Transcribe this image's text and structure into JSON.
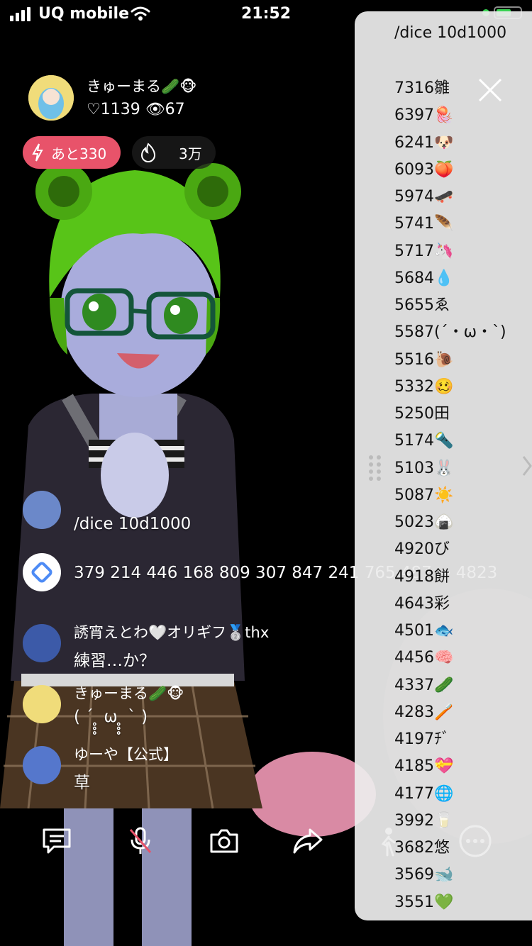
{
  "status_bar": {
    "carrier": "UQ mobile",
    "time": "21:52",
    "signal_icon": "signal-icon",
    "wifi_icon": "wifi-icon",
    "battery_icon": "battery-icon",
    "accent_green": "#39d353"
  },
  "host": {
    "name": "きゅーまる🥒🐵",
    "stats": "♡1139 👁67"
  },
  "pills": {
    "remaining": "あと330",
    "fire_count": "3万",
    "remaining_color": "#e8536a"
  },
  "chat": {
    "messages": [
      {
        "name": "",
        "text": "/dice 10d1000",
        "avatar": "avatar"
      },
      {
        "name": "",
        "text": "379 214 446 168 809 307 847 241 765 487 → 4823",
        "avatar": "bot-logo-icon"
      },
      {
        "name": "誘宵えとわ🤍オリギフ🥈thx",
        "text": "練習…か？",
        "avatar": "avatar"
      },
      {
        "name": "きゅーまる🥒🐵",
        "text": "( ´ ̥̥̥ ω ̥̥̥ ` )",
        "avatar": "avatar"
      },
      {
        "name": "ゆーや【公式】",
        "text": "草",
        "avatar": "avatar"
      }
    ]
  },
  "toolbar": {
    "buttons": [
      "comment-icon",
      "mic-muted-icon",
      "camera-icon",
      "share-icon",
      "person-icon",
      "more-icon"
    ]
  },
  "dice_panel": {
    "command": "/dice 10d1000",
    "results": [
      "7316雛",
      "6397🪼",
      "6241🐶",
      "6093🍑",
      "5974🛹",
      "5741🪶",
      "5717🦄",
      "5684💧",
      "5655ゑ",
      "5587(´・ω・`)",
      "5516🐌",
      "5332🥴",
      "5250田",
      "5174🔦",
      "5103🐰",
      "5087☀️",
      "5023🍙",
      "4920び",
      "4918餅",
      "4643彩",
      "4501🐟",
      "4456🧠",
      "4337🥒",
      "4283🪥",
      "4197ﾁﾞ",
      "4185💝",
      "4177🌐",
      "3992🥛",
      "3682悠",
      "3569🐋",
      "3551💚"
    ]
  }
}
